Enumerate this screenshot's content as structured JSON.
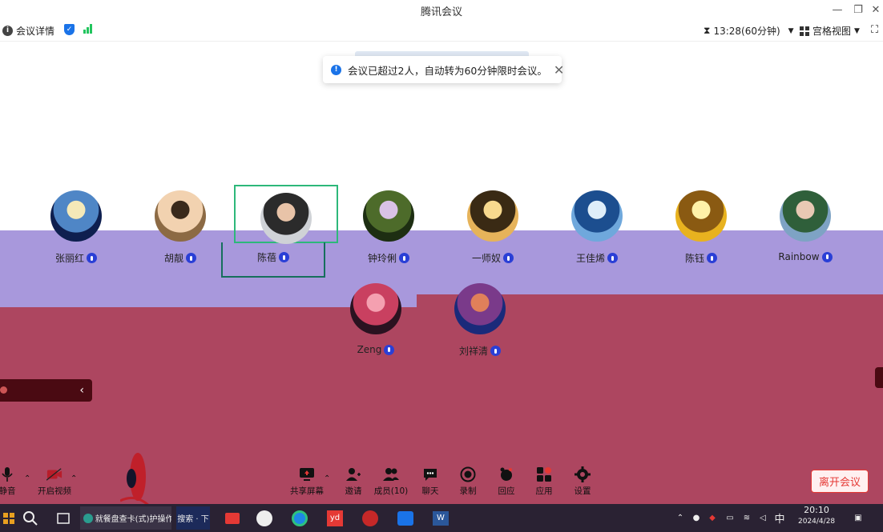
{
  "window": {
    "title": "腾讯会议",
    "minimize": "—",
    "restore": "❐",
    "close": "✕"
  },
  "toolbar": {
    "meeting_details": "会议详情",
    "timer": "13:28(60分钟)",
    "view_mode": "宫格视图",
    "timer_icon": "hourglass-icon",
    "fullscreen_icon": "fullscreen-icon"
  },
  "notification": {
    "message": "会议已超过2人，自动转为60分钟限时会议。",
    "close": "✕"
  },
  "participants": [
    {
      "name": "张丽红",
      "avatar_colors": [
        "#0e1f4f",
        "#4f86c6",
        "#f5e9b8"
      ]
    },
    {
      "name": "胡靓",
      "avatar_colors": [
        "#8c6a44",
        "#f2d2b0",
        "#3a2a1c"
      ]
    },
    {
      "name": "陈蓓",
      "avatar_colors": [
        "#cfd2d6",
        "#2b2b2b",
        "#e8c3a8"
      ]
    },
    {
      "name": "钟玲俐",
      "avatar_colors": [
        "#1d2e12",
        "#4d6b2a",
        "#d9c2e6"
      ]
    },
    {
      "name": "一师奴",
      "avatar_colors": [
        "#e6b35a",
        "#3a2a14",
        "#f7d98e"
      ]
    },
    {
      "name": "王佳烯",
      "avatar_colors": [
        "#6fa8dc",
        "#1c4e8f",
        "#dfeef9"
      ]
    },
    {
      "name": "陈钰",
      "avatar_colors": [
        "#e8b21f",
        "#8a5a12",
        "#fff2a8"
      ]
    },
    {
      "name": "Rainbow",
      "avatar_colors": [
        "#7ea3c4",
        "#2f5f3a",
        "#e8c9b4"
      ]
    },
    {
      "name": "Zeng",
      "avatar_colors": [
        "#2a1220",
        "#c94060",
        "#f4a0b0"
      ]
    },
    {
      "name": "刘祥清",
      "avatar_colors": [
        "#1a2a7a",
        "#7a3a8a",
        "#e0805a"
      ]
    }
  ],
  "controls": {
    "mute": "静音",
    "start_video": "开启视频",
    "share_screen": "共享屏幕",
    "invite": "邀请",
    "members": "成员(10)",
    "chat": "聊天",
    "record": "录制",
    "react": "回应",
    "apps": "应用",
    "settings": "设置",
    "leave": "离开会议"
  },
  "taskbar": {
    "search_app": "就餐盘查卡(式)护操作",
    "search_app2": "搜索 · 下",
    "app_yd": "yd",
    "app_w": "W",
    "ime": "中",
    "time": "20:10",
    "date": "2024/4/28"
  },
  "colors": {
    "accent_blue": "#1a73e8",
    "leave_red": "#e53935",
    "active_border": "#2db87a",
    "mic_blue": "#2a3fd6"
  }
}
